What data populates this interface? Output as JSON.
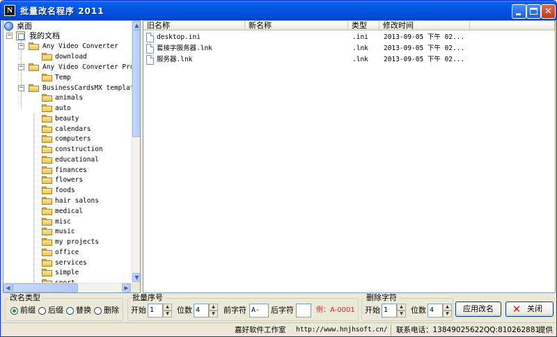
{
  "window": {
    "title": "批量改名程序 2011",
    "icon_letter": "N",
    "controls": {
      "minimize": "minimize",
      "maximize": "maximize",
      "close": "✕"
    }
  },
  "tree": {
    "desktop": "桌面",
    "my_documents": "我的文档",
    "nodes": [
      {
        "label": "Any Video Converter",
        "expander": "⊟"
      },
      {
        "label": "download"
      },
      {
        "label": "Any Video Converter Pro",
        "expander": "⊟"
      },
      {
        "label": "Temp"
      },
      {
        "label": "BusinessCardsMX templat",
        "expander": "⊟"
      }
    ],
    "children": [
      "animals",
      "auto",
      "beauty",
      "calendars",
      "computers",
      "construction",
      "educational",
      "finances",
      "flowers",
      "foods",
      "hair salons",
      "medical",
      "misc",
      "music",
      "my projects",
      "office",
      "services",
      "simple",
      "sport"
    ]
  },
  "file_list": {
    "columns": [
      "旧名称",
      "新名称",
      "类型",
      "修改时间"
    ],
    "rows": [
      {
        "old": "desktop.ini",
        "new": "",
        "type": ".ini",
        "modified": "2013-09-05 下午 02..."
      },
      {
        "old": "套接字服务器.lnk",
        "new": "",
        "type": ".lnk",
        "modified": "2013-09-05 下午 02..."
      },
      {
        "old": "服务器.lnk",
        "new": "",
        "type": ".lnk",
        "modified": "2013-09-05 下午 02..."
      }
    ]
  },
  "rename_type": {
    "title": "改名类型",
    "options": [
      "前缀",
      "后缀",
      "替换",
      "删除"
    ],
    "selected": "前缀"
  },
  "batch_seq": {
    "title": "批量序号",
    "start_label": "开始",
    "start_value": "1",
    "digits_label": "位数",
    "digits_value": "4",
    "prefix_label": "前字符",
    "prefix_value": "A-",
    "suffix_label": "后字符",
    "suffix_value": "",
    "example": "例：A-0001",
    "example_color": "#e02020"
  },
  "delete_chars": {
    "title": "删除字符",
    "start_label": "开始",
    "start_value": "1",
    "digits_label": "位数",
    "digits_value": "4"
  },
  "buttons": {
    "apply": "应用改名",
    "close": "关闭"
  },
  "status": {
    "studio": "嘉好软件工作室",
    "url": "http://www.hnjhsoft.cn/",
    "phone": "联系电话：13849025622",
    "qq": "QQ:810262881",
    "provider": "提供"
  },
  "colors": {
    "titlebar": "#0054e3",
    "accent_red": "#e02020"
  }
}
